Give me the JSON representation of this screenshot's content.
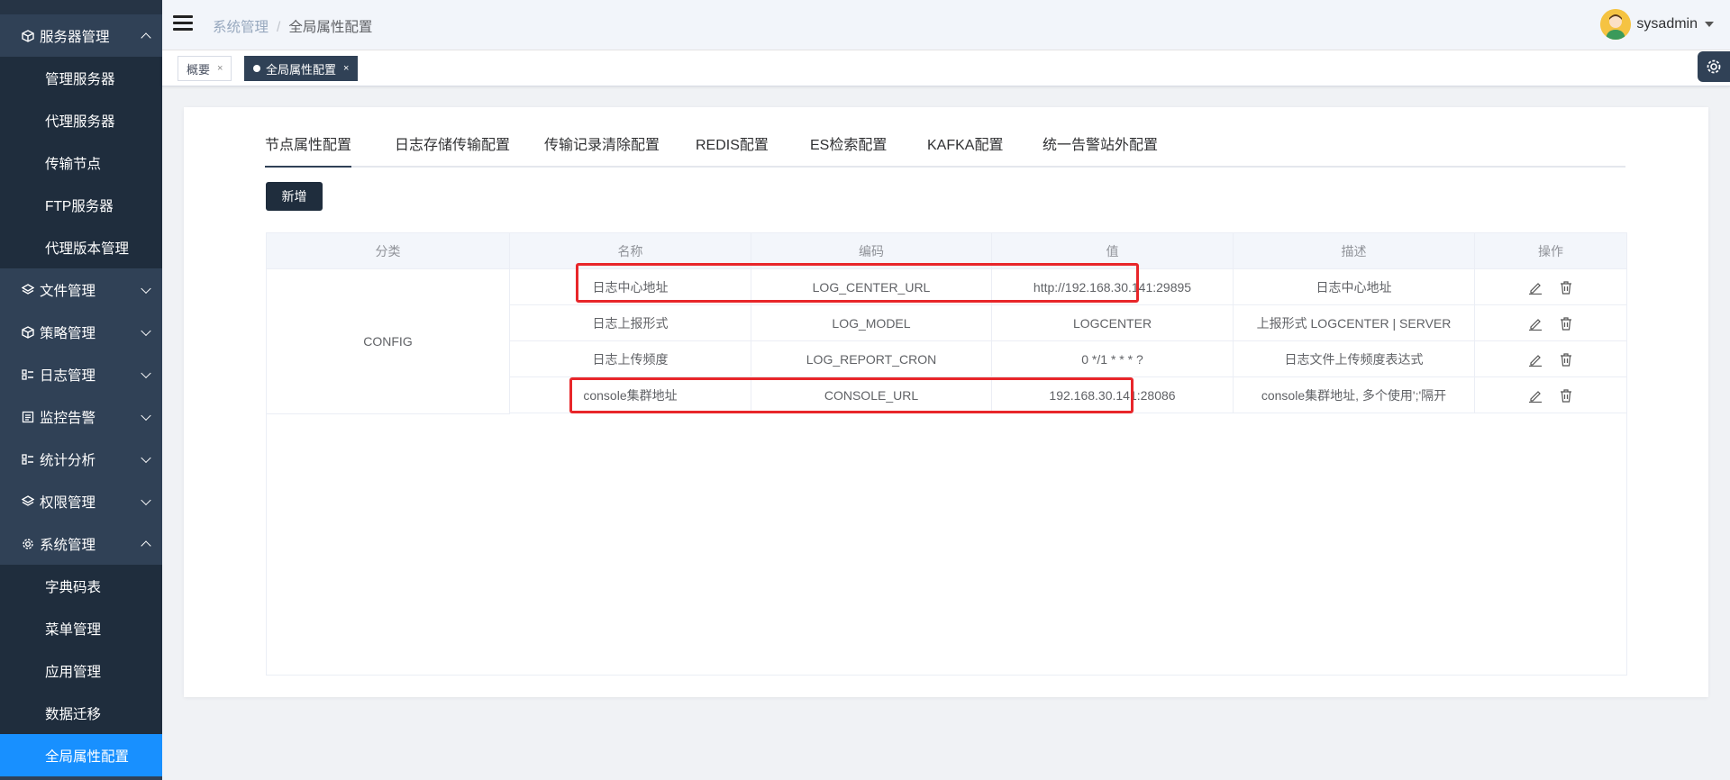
{
  "sidebar": {
    "items": [
      {
        "label": "服务器管理",
        "expanded": true,
        "children": [
          "管理服务器",
          "代理服务器",
          "传输节点",
          "FTP服务器",
          "代理版本管理"
        ]
      },
      {
        "label": "文件管理",
        "expanded": false
      },
      {
        "label": "策略管理",
        "expanded": false
      },
      {
        "label": "日志管理",
        "expanded": false
      },
      {
        "label": "监控告警",
        "expanded": false
      },
      {
        "label": "统计分析",
        "expanded": false
      },
      {
        "label": "权限管理",
        "expanded": false
      },
      {
        "label": "系统管理",
        "expanded": true,
        "children": [
          "字典码表",
          "菜单管理",
          "应用管理",
          "数据迁移",
          "全局属性配置"
        ]
      }
    ],
    "active_item": "全局属性配置",
    "active_color": "#1890ff"
  },
  "header": {
    "breadcrumb": [
      "系统管理",
      "全局属性配置"
    ],
    "username": "sysadmin"
  },
  "tags": [
    {
      "label": "概要",
      "close": "×"
    },
    {
      "label": "全局属性配置",
      "close": "×",
      "active": true
    }
  ],
  "tabs": [
    "节点属性配置",
    "日志存储传输配置",
    "传输记录清除配置",
    "REDIS配置",
    "ES检索配置",
    "KAFKA配置",
    "统一告警站外配置"
  ],
  "active_tab": "节点属性配置",
  "toolbar": {
    "add_label": "新增"
  },
  "table": {
    "headers": [
      "分类",
      "名称",
      "编码",
      "值",
      "描述",
      "操作"
    ],
    "category": "CONFIG",
    "rows": [
      {
        "name": "日志中心地址",
        "code": "LOG_CENTER_URL",
        "value": "http://192.168.30.141:29895",
        "desc": "日志中心地址",
        "highlighted": true
      },
      {
        "name": "日志上报形式",
        "code": "LOG_MODEL",
        "value": "LOGCENTER",
        "desc": "上报形式 LOGCENTER | SERVER",
        "highlighted": false
      },
      {
        "name": "日志上传频度",
        "code": "LOG_REPORT_CRON",
        "value": "0 */1 * * * ?",
        "desc": "日志文件上传频度表达式",
        "highlighted": false
      },
      {
        "name": "console集群地址",
        "code": "CONSOLE_URL",
        "value": "192.168.30.141:28086",
        "desc": "console集群地址, 多个使用';'隔开",
        "highlighted": true
      }
    ],
    "row_icons": [
      "edit-icon",
      "delete-icon"
    ]
  },
  "highlight_color": "#e8262a"
}
